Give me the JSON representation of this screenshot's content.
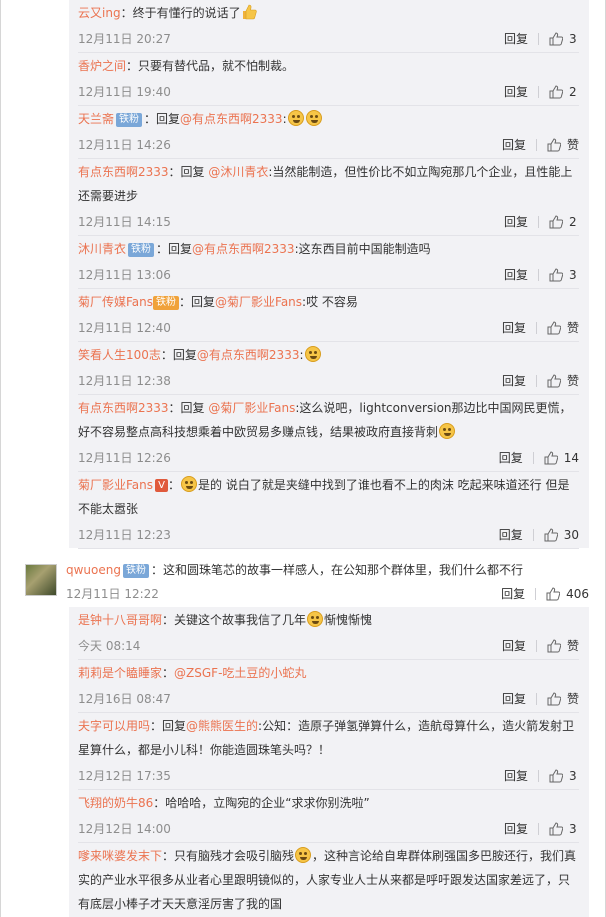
{
  "replies_a": [
    {
      "name": "云又ing",
      "badge": "",
      "text_parts": [
        {
          "t": "：终于有懂行的说话了"
        }
      ],
      "emoji": [
        "thumbs-up"
      ],
      "time": "12月11日 20:27",
      "like": "3"
    },
    {
      "name": "香炉之间",
      "badge": "",
      "text_parts": [
        {
          "t": "：只要有替代品，就不怕制裁。"
        }
      ],
      "emoji": [],
      "time": "12月11日 19:40",
      "like": "2"
    },
    {
      "name": "天兰斋",
      "badge": "铁粉",
      "text_parts": [
        {
          "t": "：回复"
        },
        {
          "m": "@有点东西啊2333"
        },
        {
          "t": ":"
        }
      ],
      "emoji": [
        "laugh",
        "laugh"
      ],
      "time": "12月11日 14:26",
      "like": "赞"
    },
    {
      "name": "有点东西啊2333",
      "badge": "",
      "text_parts": [
        {
          "t": "：回复 "
        },
        {
          "m": "@沐川青衣"
        },
        {
          "t": ":当然能制造，但性价比不如立陶宛那几个企业，且性能上还需要进步"
        }
      ],
      "emoji": [],
      "time": "12月11日 14:15",
      "like": "2"
    },
    {
      "name": "沐川青衣",
      "badge": "铁粉",
      "text_parts": [
        {
          "t": "：回复"
        },
        {
          "m": "@有点东西啊2333"
        },
        {
          "t": ":这东西目前中国能制造吗"
        }
      ],
      "emoji": [],
      "time": "12月11日 13:06",
      "like": "3"
    },
    {
      "name": "菊厂传媒Fans",
      "badge": "铁粉",
      "text_parts": [
        {
          "t": "：回复"
        },
        {
          "m": "@菊厂影业Fans"
        },
        {
          "t": ":哎 不容易"
        }
      ],
      "emoji": [],
      "time": "12月11日 12:40",
      "like": "赞"
    },
    {
      "name": "笑看人生100志",
      "badge": "",
      "text_parts": [
        {
          "t": "：回复"
        },
        {
          "m": "@有点东西啊2333"
        },
        {
          "t": ":"
        }
      ],
      "emoji": [
        "laugh"
      ],
      "time": "12月11日 12:38",
      "like": "赞"
    },
    {
      "name": "有点东西啊2333",
      "badge": "",
      "text_parts": [
        {
          "t": "：回复 "
        },
        {
          "m": "@菊厂影业Fans"
        },
        {
          "t": ":这么说吧，lightconversion那边比中国网民更慌，好不容易整点高科技想乘着中欧贸易多赚点钱，结果被政府直接背刺"
        }
      ],
      "emoji": [
        "laugh"
      ],
      "time": "12月11日 12:26",
      "like": "14"
    },
    {
      "name": "菊厂影业Fans",
      "badge": "",
      "vip": "V",
      "text_parts": [
        {
          "t": "："
        },
        {
          "t": "是的  说白了就是夹缝中找到了谁也看不上的肉沫  吃起来味道还行  但是不能太嚣张"
        }
      ],
      "emoji": [
        "laugh"
      ],
      "time": "12月11日 12:23",
      "like": "30"
    }
  ],
  "main": {
    "name": "qwuoeng",
    "badge": "铁粉",
    "text": "：这和圆珠笔芯的故事一样感人，在公知那个群体里，我们什么都不行",
    "time": "12月11日 12:22",
    "like": "406"
  },
  "replies_b": [
    {
      "name": "是钟十八哥哥啊",
      "text_pre": "：关键这个故事我信了几年",
      "text_post": "惭愧惭愧",
      "time": "今天 08:14",
      "like": "赞"
    },
    {
      "name": "莉莉是个瞌睡家",
      "text_pre": "：",
      "mention": "@ZSGF-吃土豆的小蛇丸",
      "text_post": "",
      "time": "12月16日 08:47",
      "like": "赞"
    },
    {
      "name": "夫字可以用吗",
      "text_pre": "：回复",
      "mention": "@熊熊医生的",
      "text_post": ":公知：造原子弹氢弹算什么，造航母算什么，造火箭发射卫星算什么，都是小儿科！你能造圆珠笔头吗？！",
      "time": "12月12日 17:35",
      "like": "3"
    },
    {
      "name": "飞翔的奶牛86",
      "text_pre": "：哈哈哈，立陶宛的企业“求求你别洗啦”",
      "time": "12月12日 14:00",
      "like": "3"
    },
    {
      "name": "嗲来咪婆发末下",
      "text_pre": "：只有脑残才会吸引脑残",
      "text_post": "，这种言论给自卑群体刷强国多巴胺还行，我们真实的产业水平很多从业者心里跟明镜似的，人家专业人士从来都是呼吁跟发达国家差远了，只有底层小棒子才天天意淫厉害了我的国"
    }
  ],
  "ui": {
    "reply_label": "回复",
    "like_icon": "thumb-icon",
    "accent": "#eb7350"
  }
}
